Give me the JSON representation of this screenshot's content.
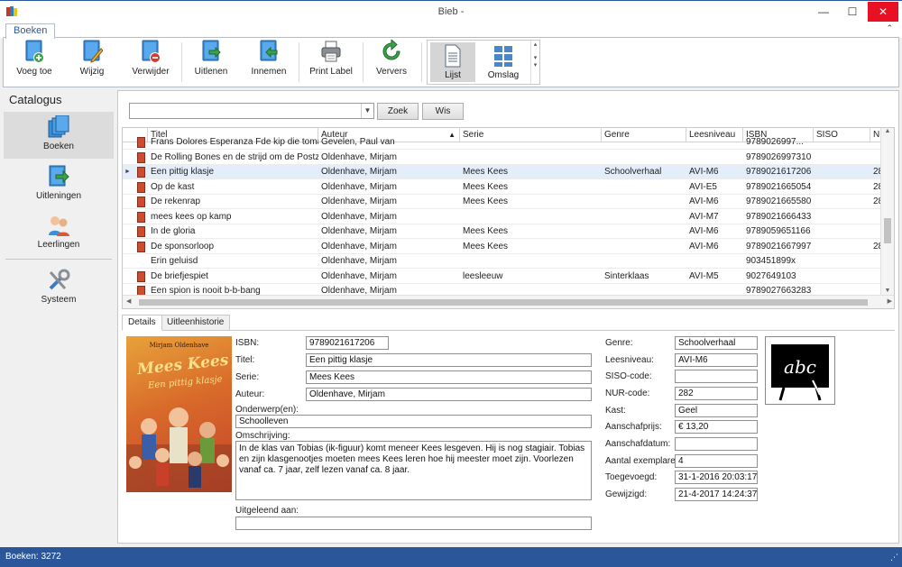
{
  "window": {
    "title": "Bieb -",
    "controls": {
      "minimize": "—",
      "maximize": "☐",
      "close": "✕"
    }
  },
  "ribbon": {
    "tab": "Boeken",
    "buttons": {
      "add": "Voeg toe",
      "edit": "Wijzig",
      "delete": "Verwijder",
      "lend": "Uitlenen",
      "return": "Innemen",
      "print": "Print Label",
      "refresh": "Ververs"
    },
    "views": {
      "list": "Lijst",
      "cover": "Omslag"
    }
  },
  "nav": {
    "title": "Catalogus",
    "items": [
      "Boeken",
      "Uitleningen",
      "Leerlingen",
      "Systeem"
    ]
  },
  "search": {
    "value": "",
    "search_button": "Zoek",
    "clear_button": "Wis"
  },
  "table": {
    "columns": [
      "Titel",
      "Auteur",
      "Serie",
      "Genre",
      "Leesniveau",
      "ISBN",
      "SISO",
      "NU"
    ],
    "rows": [
      {
        "titel": "Frans Dolores Esperanza Fde kip die tomaten...",
        "auteur": "Gevelen, Paul van",
        "serie": "",
        "genre": "",
        "niveau": "",
        "isbn": "9789026997...",
        "siso": "",
        "nu": ""
      },
      {
        "titel": "De Rolling Bones en de strijd om de Postzegel",
        "auteur": "Oldenhave, Mirjam",
        "serie": "",
        "genre": "",
        "niveau": "",
        "isbn": "9789026997310",
        "siso": "",
        "nu": ""
      },
      {
        "titel": "Een pittig klasje",
        "auteur": "Oldenhave, Mirjam",
        "serie": "Mees Kees",
        "genre": "Schoolverhaal",
        "niveau": "AVI-M6",
        "isbn": "9789021617206",
        "siso": "",
        "nu": "28"
      },
      {
        "titel": "Op de kast",
        "auteur": "Oldenhave, Mirjam",
        "serie": "Mees Kees",
        "genre": "",
        "niveau": "AVI-E5",
        "isbn": "9789021665054",
        "siso": "",
        "nu": "28"
      },
      {
        "titel": "De rekenrap",
        "auteur": "Oldenhave, Mirjam",
        "serie": "Mees Kees",
        "genre": "",
        "niveau": "AVI-M6",
        "isbn": "9789021665580",
        "siso": "",
        "nu": "28"
      },
      {
        "titel": "mees kees op kamp",
        "auteur": "Oldenhave, Mirjam",
        "serie": "",
        "genre": "",
        "niveau": "AVI-M7",
        "isbn": "9789021666433",
        "siso": "",
        "nu": ""
      },
      {
        "titel": "In de gloria",
        "auteur": "Oldenhave, Mirjam",
        "serie": "Mees Kees",
        "genre": "",
        "niveau": "AVI-M6",
        "isbn": "9789059651166",
        "siso": "",
        "nu": ""
      },
      {
        "titel": "De sponsorloop",
        "auteur": "Oldenhave, Mirjam",
        "serie": "Mees Kees",
        "genre": "",
        "niveau": "AVI-M6",
        "isbn": "9789021667997",
        "siso": "",
        "nu": "28"
      },
      {
        "titel": "Erin geluisd",
        "auteur": "Oldenhave, Mirjam",
        "serie": "",
        "genre": "",
        "niveau": "",
        "isbn": "903451899x",
        "siso": "",
        "nu": ""
      },
      {
        "titel": "De briefjespiet",
        "auteur": "Oldenhave, Mirjam",
        "serie": "leesleeuw",
        "genre": "Sinterklaas",
        "niveau": "AVI-M5",
        "isbn": "9027649103",
        "siso": "",
        "nu": ""
      },
      {
        "titel": "Een spion is nooit b-b-bang",
        "auteur": "Oldenhave, Mirjam",
        "serie": "",
        "genre": "",
        "niveau": "",
        "isbn": "9789027663283",
        "siso": "",
        "nu": ""
      }
    ]
  },
  "detail_tabs": [
    "Details",
    "Uitleenhistorie"
  ],
  "cover": {
    "author": "Mirjam Oldenhave",
    "title": "Mees Kees",
    "subtitle": "Een pittig klasje"
  },
  "details": {
    "isbn": {
      "label": "ISBN:",
      "value": "9789021617206"
    },
    "titel": {
      "label": "Titel:",
      "value": "Een pittig klasje"
    },
    "serie": {
      "label": "Serie:",
      "value": "Mees Kees"
    },
    "auteur": {
      "label": "Auteur:",
      "value": "Oldenhave, Mirjam"
    },
    "onderwerp": {
      "label": "Onderwerp(en):",
      "value": "Schoolleven"
    },
    "omschrijving": {
      "label": "Omschrijving:",
      "value": "In de klas van Tobias (ik-figuur) komt meneer Kees lesgeven. Hij is nog stagiair. Tobias en zijn klasgenootjes moeten mees Kees leren hoe hij meester moet zijn. Voorlezen vanaf ca. 7 jaar, zelf lezen vanaf ca. 8 jaar."
    },
    "uitgeleend": {
      "label": "Uitgeleend aan:",
      "value": ""
    },
    "genre": {
      "label": "Genre:",
      "value": "Schoolverhaal"
    },
    "leesniveau": {
      "label": "Leesniveau:",
      "value": "AVI-M6"
    },
    "siso": {
      "label": "SISO-code:",
      "value": ""
    },
    "nur": {
      "label": "NUR-code:",
      "value": "282"
    },
    "kast": {
      "label": "Kast:",
      "value": "Geel"
    },
    "prijs": {
      "label": "Aanschafprijs:",
      "value": "€ 13,20"
    },
    "aanschafdatum": {
      "label": "Aanschafdatum:",
      "value": ""
    },
    "exemplaren": {
      "label": "Aantal exemplaren:",
      "value": "4"
    },
    "toegevoegd": {
      "label": "Toegevoegd:",
      "value": "31-1-2016 20:03:17"
    },
    "gewijzigd": {
      "label": "Gewijzigd:",
      "value": "21-4-2017 14:24:37"
    },
    "avi_icon_text": "abc"
  },
  "status": {
    "text": "Boeken: 3272"
  },
  "colors": {
    "accent": "#2b579a",
    "selected_row": "#e4eefb",
    "close": "#e81123"
  }
}
